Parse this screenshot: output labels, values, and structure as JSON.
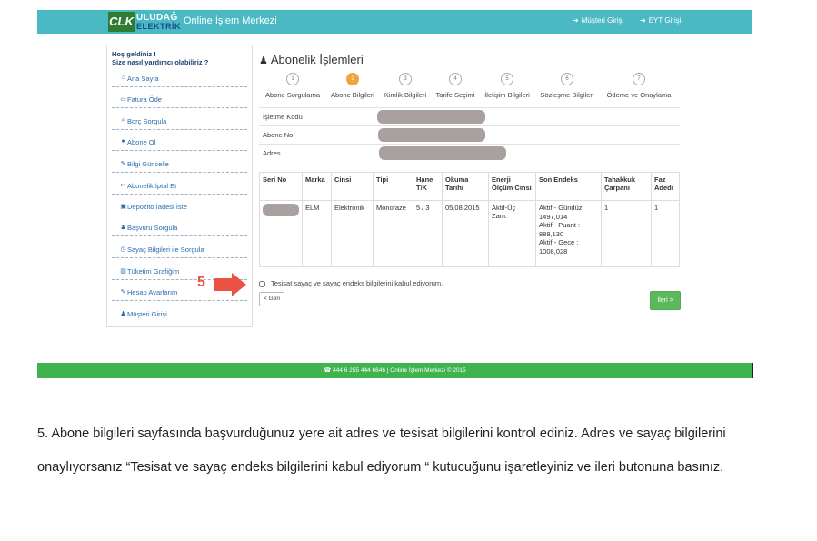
{
  "header": {
    "logo_mark": "CLK",
    "logo_line1": "ULUDAĞ",
    "logo_line2": "ELEKTRİK",
    "site_title": "Online İşlem Merkezi",
    "nav": [
      {
        "label": "Müşteri Girişi",
        "icon": "sign-in-icon"
      },
      {
        "label": "EYT Girişi",
        "icon": "sign-in-icon"
      }
    ]
  },
  "sidebar": {
    "welcome_line1": "Hoş geldiniz !",
    "welcome_line2": "Size nasıl yardımcı olabiliriz ?",
    "items": [
      {
        "label": "Ana Sayfa",
        "icon": "home-icon"
      },
      {
        "label": "Fatura Öde",
        "icon": "credit-card-icon"
      },
      {
        "label": "Borç Sorgula",
        "icon": "search-icon"
      },
      {
        "label": "Abone Ol",
        "icon": "globe-icon"
      },
      {
        "label": "Bilgi Güncelle",
        "icon": "edit-icon"
      },
      {
        "label": "Abonelik İptal Et",
        "icon": "scissors-icon"
      },
      {
        "label": "Depozito İadesi İste",
        "icon": "money-icon"
      },
      {
        "label": "Başvuru Sorgula",
        "icon": "user-plus-icon"
      },
      {
        "label": "Sayaç Bilgileri ile Sorgula",
        "icon": "clock-icon"
      },
      {
        "label": "Tüketim Grafiğim",
        "icon": "bar-chart-icon"
      },
      {
        "label": "Hesap Ayarlarım",
        "icon": "edit-icon"
      },
      {
        "label": "Müşteri Girişi",
        "icon": "users-icon"
      }
    ]
  },
  "main": {
    "title": "Abonelik İşlemleri",
    "title_icon": "user-icon",
    "steps": [
      {
        "num": "1",
        "label": "Abone Sorgulama"
      },
      {
        "num": "2",
        "label": "Abone Bilgileri",
        "active": true
      },
      {
        "num": "3",
        "label": "Kimlik Bilgileri"
      },
      {
        "num": "4",
        "label": "Tarife Seçimi"
      },
      {
        "num": "5",
        "label": "İletişim Bilgileri"
      },
      {
        "num": "6",
        "label": "Sözleşme Bilgileri"
      },
      {
        "num": "7",
        "label": "Ödeme ve Onaylama"
      }
    ],
    "info_rows": [
      {
        "key": "İşletme Kodu"
      },
      {
        "key": "Abone No"
      },
      {
        "key": "Adres"
      }
    ],
    "table": {
      "headers": [
        "Seri No",
        "Marka",
        "Cinsi",
        "Tipi",
        "Hane T/K",
        "Okuma Tarihi",
        "Enerji Ölçüm Cinsi",
        "Son Endeks",
        "Tahakkuk Çarpanı",
        "Faz Adedi"
      ],
      "row": {
        "marka": "ELM",
        "cinsi": "Elektronik",
        "tipi": "Monofaze",
        "hane": "5 / 3",
        "okuma": "05.08.2015",
        "enerji": "Aktif-Üç Zam.",
        "endeks": "Aktif - Gündüz: 1497,014\nAktif - Puant : 888,130\nAktif - Gece : 1008,028",
        "tahakkuk": "1",
        "faz": "1"
      }
    },
    "annotation_number": "5",
    "agree_label": "Tesisat sayaç ve sayaç endeks bilgilerini kabul ediyorum.",
    "back_label": "< Geri",
    "next_label": "İleri >"
  },
  "footer": {
    "text": "☎ 444 6 255 444 6646 | Online İşlem Merkezi © 2015"
  },
  "instruction": "5. Abone bilgileri sayfasında başvurduğunuz yere ait adres ve tesisat bilgilerini kontrol ediniz. Adres ve sayaç bilgilerini onaylıyorsanız  “Tesisat ve sayaç endeks bilgilerini kabul ediyorum “ kutucuğunu işaretleyiniz ve ileri butonuna basınız."
}
